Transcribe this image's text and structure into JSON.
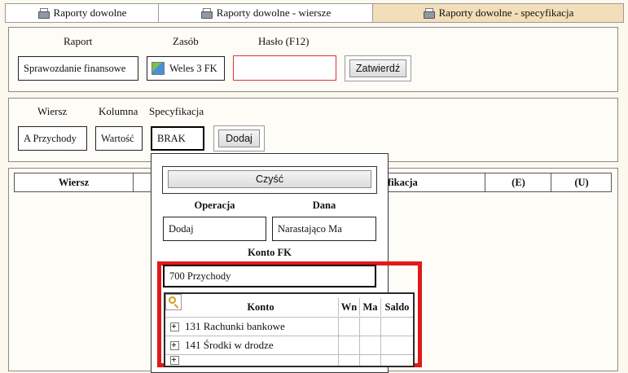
{
  "tabs": [
    {
      "label": "Raporty dowolne"
    },
    {
      "label": "Raporty dowolne - wiersze"
    },
    {
      "label": "Raporty dowolne - specyfikacja"
    }
  ],
  "header_form": {
    "raport_label": "Raport",
    "raport_value": "Sprawozdanie finansowe",
    "zasob_label": "Zasób",
    "zasob_value": "Weles 3 FK",
    "haslo_label": "Hasło (F12)",
    "haslo_value": "",
    "confirm_label": "Zatwierdź"
  },
  "row_form": {
    "wiersz_label": "Wiersz",
    "wiersz_value": "A Przychody",
    "kolumna_label": "Kolumna",
    "kolumna_value": "Wartość",
    "spec_label": "Specyfikacja",
    "spec_value": "BRAK",
    "add_label": "Dodaj"
  },
  "table": {
    "headers": [
      "Wiersz",
      "fikacja",
      "(E)",
      "(U)"
    ]
  },
  "popup": {
    "clear_label": "Czyść",
    "operacja_label": "Operacja",
    "operacja_value": "Dodaj",
    "dana_label": "Dana",
    "dana_value": "Narastająco Ma",
    "konto_label": "Konto FK",
    "konto_value": "700 Przychody",
    "grid_headers": [
      "Konto",
      "Wn",
      "Ma",
      "Saldo"
    ],
    "grid_rows": [
      {
        "konto": "131 Rachunki bankowe"
      },
      {
        "konto": "141 Środki w drodze"
      }
    ],
    "highlight_color": "#e01a1a"
  }
}
